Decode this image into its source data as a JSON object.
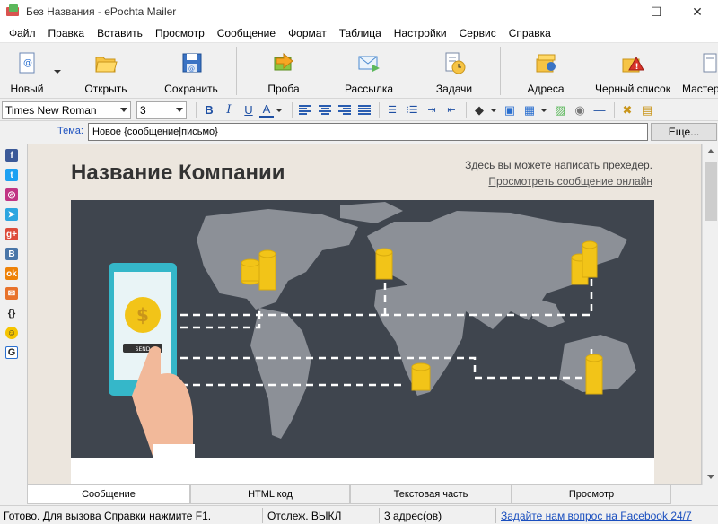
{
  "window": {
    "title": "Без Названия - ePochta Mailer",
    "controls": {
      "minimize": "—",
      "maximize": "☐",
      "close": "✕"
    }
  },
  "menu": [
    "Файл",
    "Правка",
    "Вставить",
    "Просмотр",
    "Сообщение",
    "Формат",
    "Таблица",
    "Настройки",
    "Сервис",
    "Справка"
  ],
  "toolbar": {
    "new": "Новый",
    "open": "Открыть",
    "save": "Сохранить",
    "test": "Проба",
    "send": "Рассылка",
    "tasks": "Задачи",
    "addresses": "Адреса",
    "blacklist": "Черный список",
    "wizard": "Мастер"
  },
  "format": {
    "font": "Times New Roman",
    "size": "3",
    "bold": "B",
    "italic": "I",
    "underline": "U",
    "font_color": "A"
  },
  "subject": {
    "label": "Тема:",
    "value": "Новое {сообщение|письмо}",
    "more": "Еще..."
  },
  "social": [
    {
      "name": "facebook-icon",
      "glyph": "f",
      "color": "#3b5998"
    },
    {
      "name": "twitter-icon",
      "glyph": "t",
      "color": "#1da1f2"
    },
    {
      "name": "instagram-icon",
      "glyph": "◎",
      "color": "#c13584"
    },
    {
      "name": "telegram-icon",
      "glyph": "➤",
      "color": "#2ca5e0"
    },
    {
      "name": "google-plus-icon",
      "glyph": "g+",
      "color": "#dd4b39"
    },
    {
      "name": "vk-icon",
      "glyph": "B",
      "color": "#4a76a8"
    },
    {
      "name": "odnoklassniki-icon",
      "glyph": "ok",
      "color": "#ee8208"
    },
    {
      "name": "email-icon",
      "glyph": "✉",
      "color": "#e8732c"
    },
    {
      "name": "braces-icon",
      "glyph": "{}",
      "color": "#f0f0f0"
    },
    {
      "name": "smiley-icon",
      "glyph": "☺",
      "color": "#f5c400"
    },
    {
      "name": "g-icon",
      "glyph": "G",
      "color": "#ffffff"
    }
  ],
  "email": {
    "company": "Название Компании",
    "preheader": "Здесь вы можете написать прехедер.",
    "view_online": "Просмотреть сообщение онлайн",
    "send_button": "SEND",
    "coin_symbol": "$"
  },
  "tabs": [
    "Сообщение",
    "HTML код",
    "Текстовая часть",
    "Просмотр"
  ],
  "status": {
    "ready": "Готово. Для вызова Справки нажмите F1.",
    "tracking": "Отслеж. ВЫКЛ",
    "addresses": "3 адрес(ов)",
    "facebook_link": "Задайте нам вопрос на Facebook 24/7"
  },
  "colors": {
    "hero_bg": "#3f454e",
    "map": "#8c9097",
    "coin": "#f2c418",
    "phone": "#35b7c9",
    "link": "#1a4fbf"
  }
}
